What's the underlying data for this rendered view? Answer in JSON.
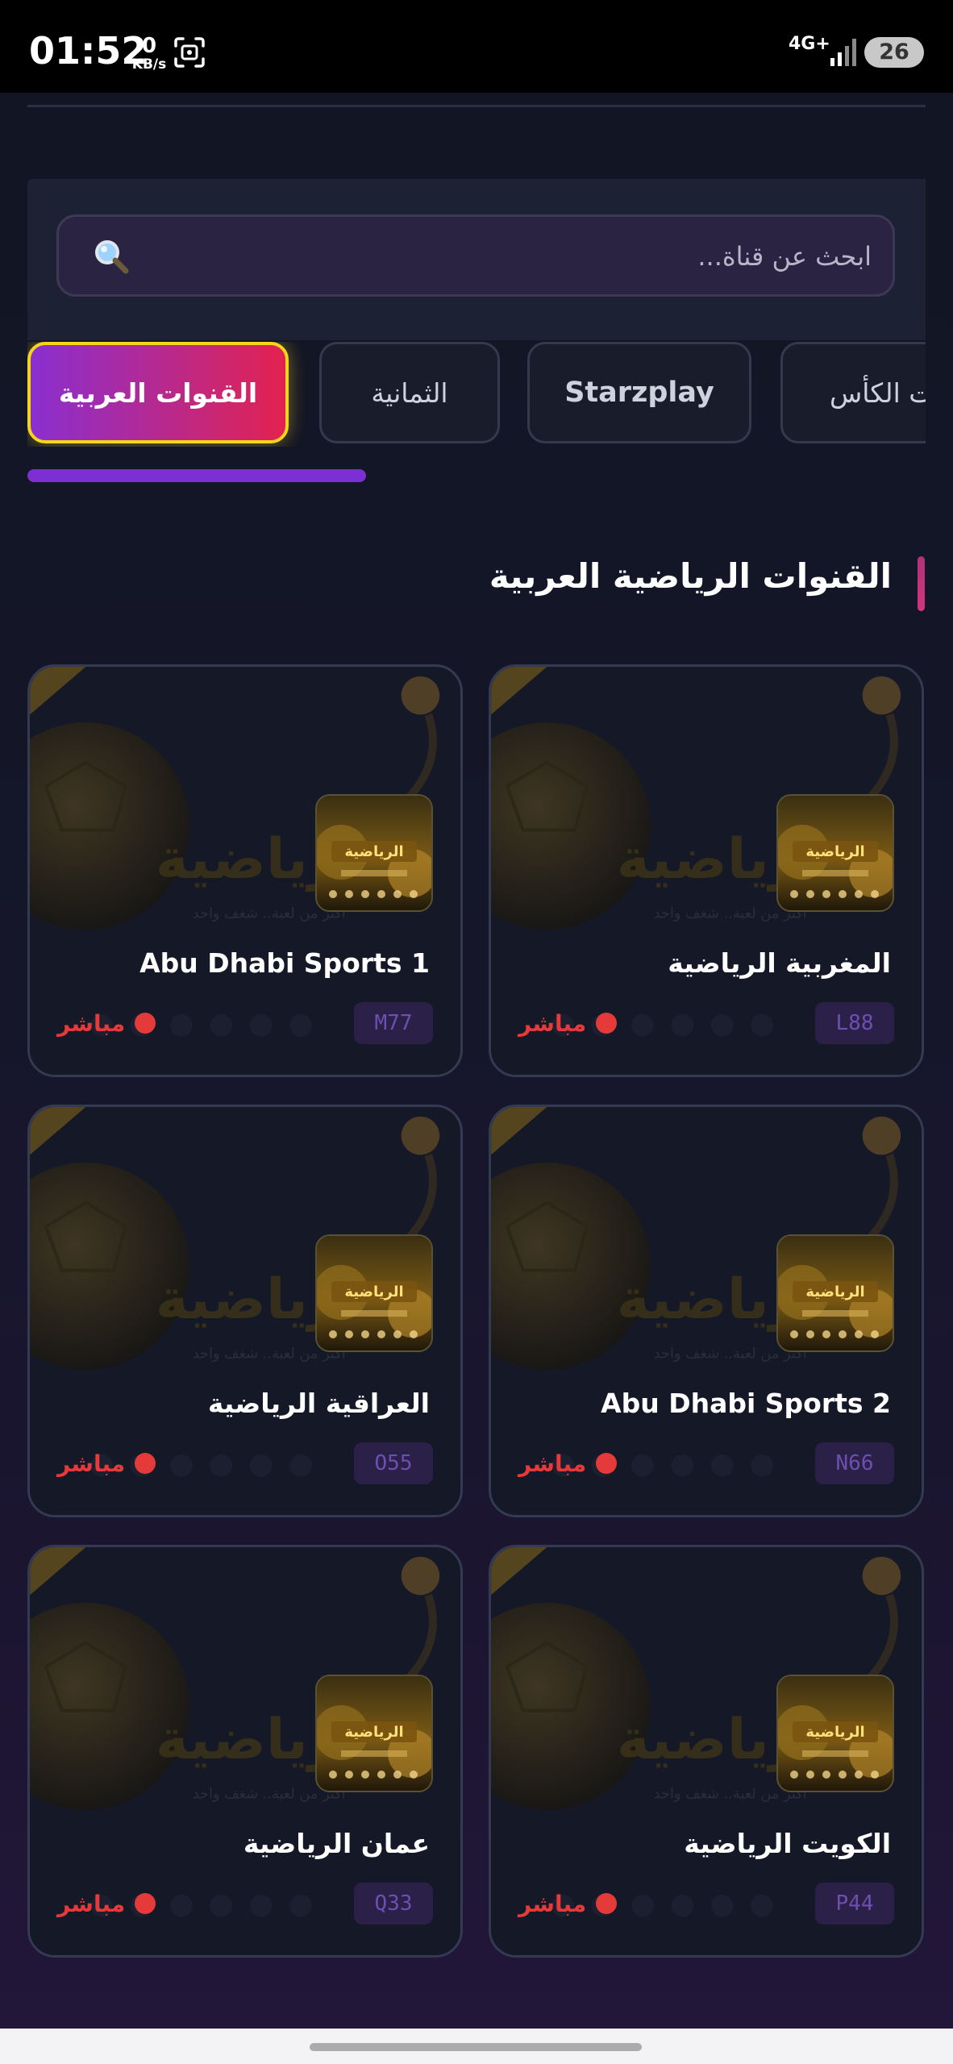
{
  "status_bar": {
    "time": "01:52",
    "speed_value": "0",
    "speed_unit": "KB/s",
    "network_type": "4G+",
    "battery": "26"
  },
  "search": {
    "placeholder": "ابحث عن قناة..."
  },
  "categories": [
    {
      "label": "القنوات العربية",
      "active": true
    },
    {
      "label": "الثمانية",
      "active": false
    },
    {
      "label": "Starzplay",
      "active": false
    },
    {
      "label": "ت الكأس",
      "active": false
    }
  ],
  "section": {
    "title": "القنوات الرياضية العربية"
  },
  "channels": [
    {
      "name": "المغربية الرياضية",
      "code": "L88",
      "live_label": "مباشر"
    },
    {
      "name": "Abu Dhabi Sports 1",
      "code": "M77",
      "live_label": "مباشر"
    },
    {
      "name": "Abu Dhabi Sports 2",
      "code": "N66",
      "live_label": "مباشر"
    },
    {
      "name": "العراقية الرياضية",
      "code": "O55",
      "live_label": "مباشر"
    },
    {
      "name": "الكويت الرياضية",
      "code": "P44",
      "live_label": "مباشر"
    },
    {
      "name": "عمان الرياضية",
      "code": "Q33",
      "live_label": "مباشر"
    }
  ],
  "colors": {
    "accent_purple": "#7d2fd3",
    "active_tab_border": "#f4d71a",
    "live_red": "#e53a3a",
    "background": "#141629"
  },
  "icons": [
    "screenshot-icon",
    "signal-icon",
    "search-icon",
    "live-dot-icon"
  ]
}
